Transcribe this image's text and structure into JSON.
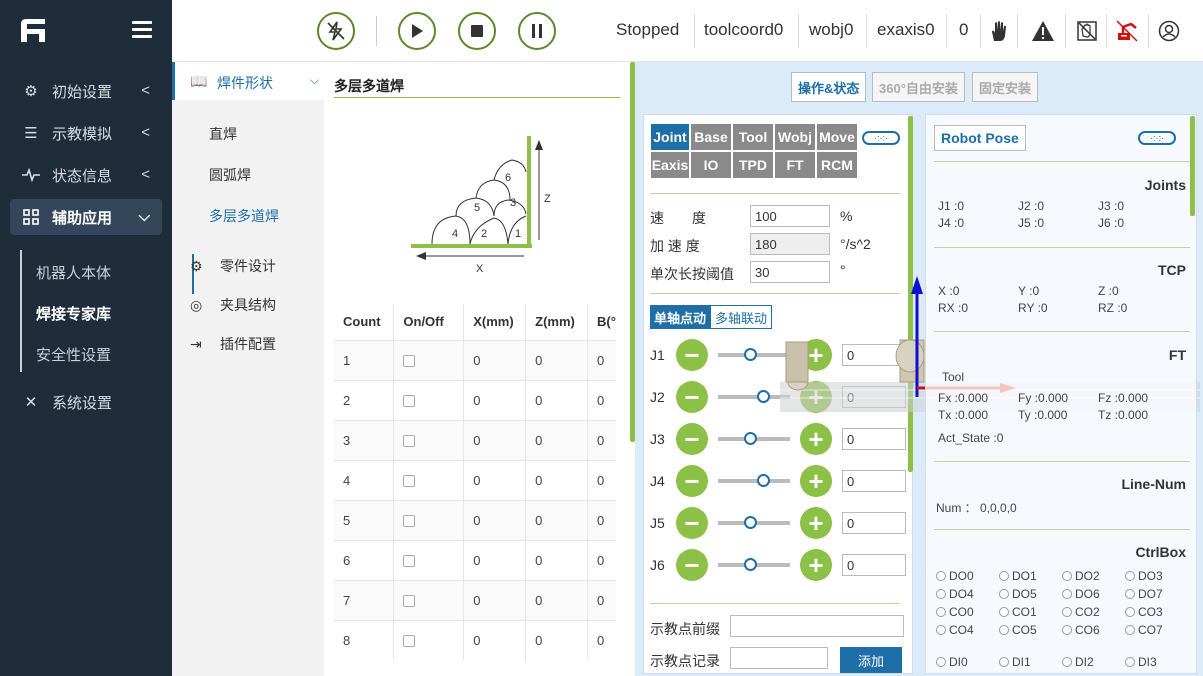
{
  "colors": {
    "nav_bg": "#1f2d3a",
    "accent_green": "#8cc046",
    "accent_blue": "#1e6ea8",
    "panel_bg": "#dcebfa"
  },
  "nav": {
    "items": [
      {
        "label": "初始设置",
        "icon": "gear-icon"
      },
      {
        "label": "示教模拟",
        "icon": "list-icon"
      },
      {
        "label": "状态信息",
        "icon": "pulse-icon"
      },
      {
        "label": "辅助应用",
        "icon": "grid-icon"
      },
      {
        "label": "系统设置",
        "icon": "tools-icon"
      }
    ],
    "subitems": [
      {
        "label": "机器人本体"
      },
      {
        "label": "焊接专家库"
      },
      {
        "label": "安全性设置"
      }
    ]
  },
  "topbar": {
    "status": "Stopped",
    "toolcoord": "toolcoord0",
    "wobj": "wobj0",
    "exaxis": "exaxis0",
    "count": "0"
  },
  "col2": {
    "header": "焊件形状",
    "subitems": [
      {
        "label": "直焊"
      },
      {
        "label": "圆弧焊"
      },
      {
        "label": "多层多道焊"
      }
    ],
    "items": [
      {
        "label": "零件设计",
        "icon": "gear-icon"
      },
      {
        "label": "夹具结构",
        "icon": "fixture-icon"
      },
      {
        "label": "插件配置",
        "icon": "plugin-icon"
      }
    ]
  },
  "main": {
    "title": "多层多道焊",
    "diagram": {
      "passes": [
        "1",
        "2",
        "3",
        "4",
        "5",
        "6"
      ],
      "x_label": "X",
      "z_label": "Z"
    },
    "table": {
      "headers": [
        "Count",
        "On/Off",
        "X(mm)",
        "Z(mm)",
        "B(°"
      ],
      "rows": [
        {
          "count": "1",
          "x": "0",
          "z": "0",
          "b": "0"
        },
        {
          "count": "2",
          "x": "0",
          "z": "0",
          "b": "0"
        },
        {
          "count": "3",
          "x": "0",
          "z": "0",
          "b": "0"
        },
        {
          "count": "4",
          "x": "0",
          "z": "0",
          "b": "0"
        },
        {
          "count": "5",
          "x": "0",
          "z": "0",
          "b": "0"
        },
        {
          "count": "6",
          "x": "0",
          "z": "0",
          "b": "0"
        },
        {
          "count": "7",
          "x": "0",
          "z": "0",
          "b": "0"
        },
        {
          "count": "8",
          "x": "0",
          "z": "0",
          "b": "0"
        }
      ]
    }
  },
  "right": {
    "tabs": [
      "操作&状态",
      "360°自由安装",
      "固定安装"
    ],
    "jog": {
      "mode_tabs": [
        [
          "Joint",
          "Base",
          "Tool",
          "Wobj",
          "Move"
        ],
        [
          "Eaxis",
          "IO",
          "TPD",
          "FT",
          "RCM"
        ]
      ],
      "speed_label": "速　　度",
      "speed_value": "100",
      "speed_unit": "%",
      "accel_label": "加 速 度",
      "accel_value": "180",
      "accel_unit": "°/s^2",
      "threshold_label": "单次长按阈值",
      "threshold_value": "30",
      "threshold_unit": "°",
      "sub_tabs": [
        "单轴点动",
        "多轴联动"
      ],
      "joints": [
        {
          "name": "J1",
          "value": "0",
          "pos": 0.45
        },
        {
          "name": "J2",
          "value": "0",
          "pos": 0.62
        },
        {
          "name": "J3",
          "value": "0",
          "pos": 0.45
        },
        {
          "name": "J4",
          "value": "0",
          "pos": 0.62
        },
        {
          "name": "J5",
          "value": "0",
          "pos": 0.45
        },
        {
          "name": "J6",
          "value": "0",
          "pos": 0.45
        }
      ],
      "prefix_label": "示教点前缀",
      "record_label": "示教点记录",
      "add_button": "添加"
    },
    "pose": {
      "title": "Robot Pose",
      "joints_header": "Joints",
      "joints": [
        {
          "k": "J1",
          "v": "0"
        },
        {
          "k": "J2",
          "v": "0"
        },
        {
          "k": "J3",
          "v": "0"
        },
        {
          "k": "J4",
          "v": "0"
        },
        {
          "k": "J5",
          "v": "0"
        },
        {
          "k": "J6",
          "v": "0"
        }
      ],
      "tcp_header": "TCP",
      "tcp": [
        {
          "k": "X",
          "v": "0"
        },
        {
          "k": "Y",
          "v": "0"
        },
        {
          "k": "Z",
          "v": "0"
        },
        {
          "k": "RX",
          "v": "0"
        },
        {
          "k": "RY",
          "v": "0"
        },
        {
          "k": "RZ",
          "v": "0"
        }
      ],
      "ft_header": "FT",
      "ft_tool": "Tool",
      "ft": [
        {
          "k": "Fx",
          "v": "0.000"
        },
        {
          "k": "Fy",
          "v": "0.000"
        },
        {
          "k": "Fz",
          "v": "0.000"
        },
        {
          "k": "Tx",
          "v": "0.000"
        },
        {
          "k": "Ty",
          "v": "0.000"
        },
        {
          "k": "Tz",
          "v": "0.000"
        }
      ],
      "act_state": "Act_State :0",
      "linenum_header": "Line-Num",
      "linenum": "Num ： 0,0,0,0",
      "ctrlbox_header": "CtrlBox",
      "ctrlbox": [
        "DO0",
        "DO1",
        "DO2",
        "DO3",
        "DO4",
        "DO5",
        "DO6",
        "DO7",
        "CO0",
        "CO1",
        "CO2",
        "CO3",
        "CO4",
        "CO5",
        "CO6",
        "CO7",
        "DI0",
        "DI1",
        "DI2",
        "DI3"
      ]
    }
  }
}
